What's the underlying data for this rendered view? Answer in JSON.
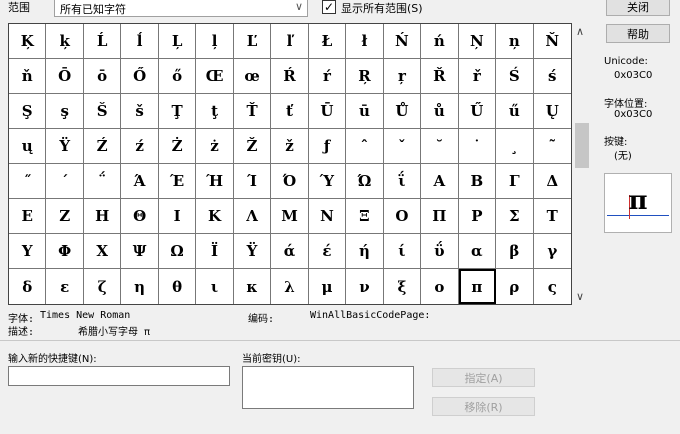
{
  "range_label": "范围",
  "range_value": "所有已知字符",
  "show_all_label": "显示所有范围(S)",
  "show_all_checked": true,
  "buttons": {
    "close": "关闭",
    "help": "帮助",
    "assign": "指定(A)",
    "remove": "移除(R)"
  },
  "side": {
    "unicode_label": "Unicode:",
    "unicode_value": "0x03C0",
    "font_pos_label": "字体位置:",
    "font_pos_value": "0x03C0",
    "key_label": "按键:",
    "key_value": "(无)"
  },
  "preview_char": "π",
  "chars": [
    [
      "Ķ",
      "ķ",
      "Ĺ",
      "ĺ",
      "Ļ",
      "ļ",
      "Ľ",
      "ľ",
      "Ł",
      "ł",
      "Ń",
      "ń",
      "Ņ",
      "ņ",
      "Ň"
    ],
    [
      "ň",
      "Ō",
      "ō",
      "Ő",
      "ő",
      "Œ",
      "œ",
      "Ŕ",
      "ŕ",
      "Ŗ",
      "ŗ",
      "Ř",
      "ř",
      "Ś",
      "ś"
    ],
    [
      "Ş",
      "ş",
      "Š",
      "š",
      "Ţ",
      "ţ",
      "Ť",
      "ť",
      "Ū",
      "ū",
      "Ů",
      "ů",
      "Ű",
      "ű",
      "Ų"
    ],
    [
      "ų",
      "Ÿ",
      "Ź",
      "ź",
      "Ż",
      "ż",
      "Ž",
      "ž",
      "ƒ",
      "ˆ",
      "ˇ",
      "˘",
      "˙",
      "¸",
      "˜"
    ],
    [
      "˝",
      "΄",
      "΅",
      "Ά",
      "Έ",
      "Ή",
      "Ί",
      "Ό",
      "Ύ",
      "Ώ",
      "ΐ",
      "Α",
      "Β",
      "Γ",
      "Δ"
    ],
    [
      "Ε",
      "Ζ",
      "Η",
      "Θ",
      "Ι",
      "Κ",
      "Λ",
      "Μ",
      "Ν",
      "Ξ",
      "Ο",
      "Π",
      "Ρ",
      "Σ",
      "Τ"
    ],
    [
      "Υ",
      "Φ",
      "Χ",
      "Ψ",
      "Ω",
      "Ϊ",
      "Ϋ",
      "ά",
      "έ",
      "ή",
      "ί",
      "ΰ",
      "α",
      "β",
      "γ"
    ],
    [
      "δ",
      "ε",
      "ζ",
      "η",
      "θ",
      "ι",
      "κ",
      "λ",
      "μ",
      "ν",
      "ξ",
      "ο",
      "π",
      "ρ",
      "ς"
    ]
  ],
  "selected_char": "π",
  "font_label": "字体:",
  "font_value": "Times New Roman",
  "encoding_label": "编码:",
  "encoding_value": "WinAllBasicCodePage:",
  "desc_label": "描述:",
  "desc_value": "希腊小写字母 π",
  "new_key_label": "输入新的快捷键(N):",
  "current_key_label": "当前密钥(U):"
}
